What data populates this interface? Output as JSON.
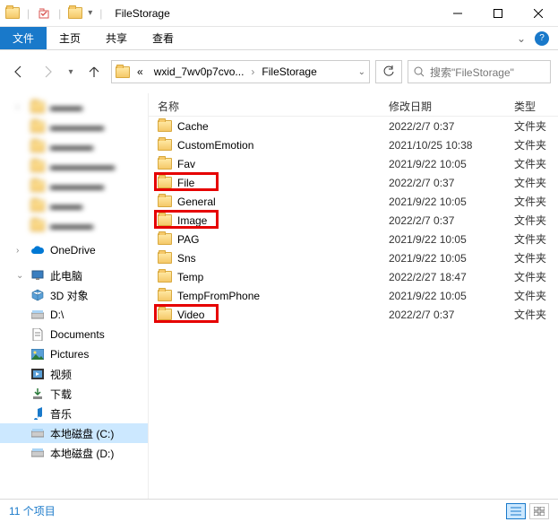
{
  "titlebar": {
    "title": "FileStorage"
  },
  "ribbon": {
    "file": "文件",
    "home": "主页",
    "share": "共享",
    "view": "查看"
  },
  "nav": {
    "crumb_prefix": "«",
    "crumb1": "wxid_7wv0p7cvo...",
    "crumb2": "FileStorage",
    "search_placeholder": "搜索\"FileStorage\""
  },
  "sidebar": {
    "blurred": [
      "▬▬▬",
      "▬▬▬▬▬",
      "▬▬▬▬",
      "▬▬▬▬▬▬",
      "▬▬▬▬▬",
      "▬▬▬",
      "▬▬▬▬"
    ],
    "onedrive": "OneDrive",
    "thispc": "此电脑",
    "items": [
      {
        "label": "3D 对象"
      },
      {
        "label": "D:\\"
      },
      {
        "label": "Documents"
      },
      {
        "label": "Pictures"
      },
      {
        "label": "视频"
      },
      {
        "label": "下载"
      },
      {
        "label": "音乐"
      },
      {
        "label": "本地磁盘 (C:)"
      },
      {
        "label": "本地磁盘 (D:)"
      }
    ]
  },
  "columns": {
    "name": "名称",
    "date": "修改日期",
    "type": "类型"
  },
  "rows": [
    {
      "name": "Cache",
      "date": "2022/2/7 0:37",
      "type": "文件夹",
      "hl": false
    },
    {
      "name": "CustomEmotion",
      "date": "2021/10/25 10:38",
      "type": "文件夹",
      "hl": false
    },
    {
      "name": "Fav",
      "date": "2021/9/22 10:05",
      "type": "文件夹",
      "hl": false
    },
    {
      "name": "File",
      "date": "2022/2/7 0:37",
      "type": "文件夹",
      "hl": true
    },
    {
      "name": "General",
      "date": "2021/9/22 10:05",
      "type": "文件夹",
      "hl": false
    },
    {
      "name": "Image",
      "date": "2022/2/7 0:37",
      "type": "文件夹",
      "hl": true
    },
    {
      "name": "PAG",
      "date": "2021/9/22 10:05",
      "type": "文件夹",
      "hl": false
    },
    {
      "name": "Sns",
      "date": "2021/9/22 10:05",
      "type": "文件夹",
      "hl": false
    },
    {
      "name": "Temp",
      "date": "2022/2/27 18:47",
      "type": "文件夹",
      "hl": false
    },
    {
      "name": "TempFromPhone",
      "date": "2021/9/22 10:05",
      "type": "文件夹",
      "hl": false
    },
    {
      "name": "Video",
      "date": "2022/2/7 0:37",
      "type": "文件夹",
      "hl": true
    }
  ],
  "status": {
    "count": "11 个项目"
  }
}
